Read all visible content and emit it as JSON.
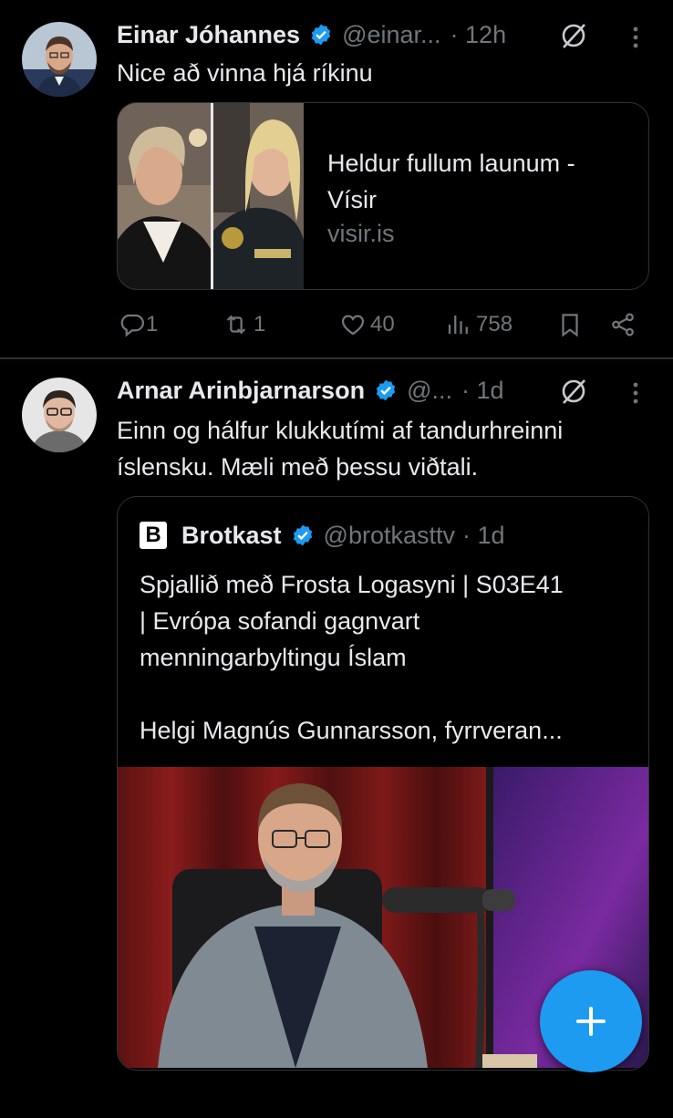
{
  "tweets": [
    {
      "author": "Einar Jóhannes",
      "handle": "@einar...",
      "time": "· 12h",
      "text": "Nice að vinna hjá ríkinu",
      "card": {
        "title_line1": "Heldur fullum launum -",
        "title_line2": "Vísir",
        "domain": "visir.is"
      },
      "actions": {
        "replies": "1",
        "reposts": "1",
        "likes": "40",
        "views": "758"
      }
    },
    {
      "author": "Arnar Arinbjarnarson",
      "handle": "@...",
      "time": "· 1d",
      "text_line1": "Einn og hálfur klukkutími af tandurhreinni",
      "text_line2": "íslensku. Mæli með þessu viðtali.",
      "quote": {
        "logo_letter": "B",
        "author": "Brotkast",
        "handle": "@brotkasttv",
        "time": "· 1d",
        "line1": "Spjallið með Frosta Logasyni | S03E41",
        "line2": "| Evrópa sofandi gagnvart",
        "line3": "menningarbyltingu Íslam",
        "line4": "Helgi Magnús Gunnarsson, fyrrveran..."
      }
    }
  ],
  "colors": {
    "accent": "#1d9bf0",
    "muted": "#71767b",
    "border": "#2f3336",
    "background": "#000000"
  },
  "icons": [
    "reply-icon",
    "repost-icon",
    "like-icon",
    "views-icon",
    "bookmark-icon",
    "share-icon",
    "grok-icon",
    "more-icon",
    "verified-badge-icon",
    "compose-plus-icon"
  ]
}
